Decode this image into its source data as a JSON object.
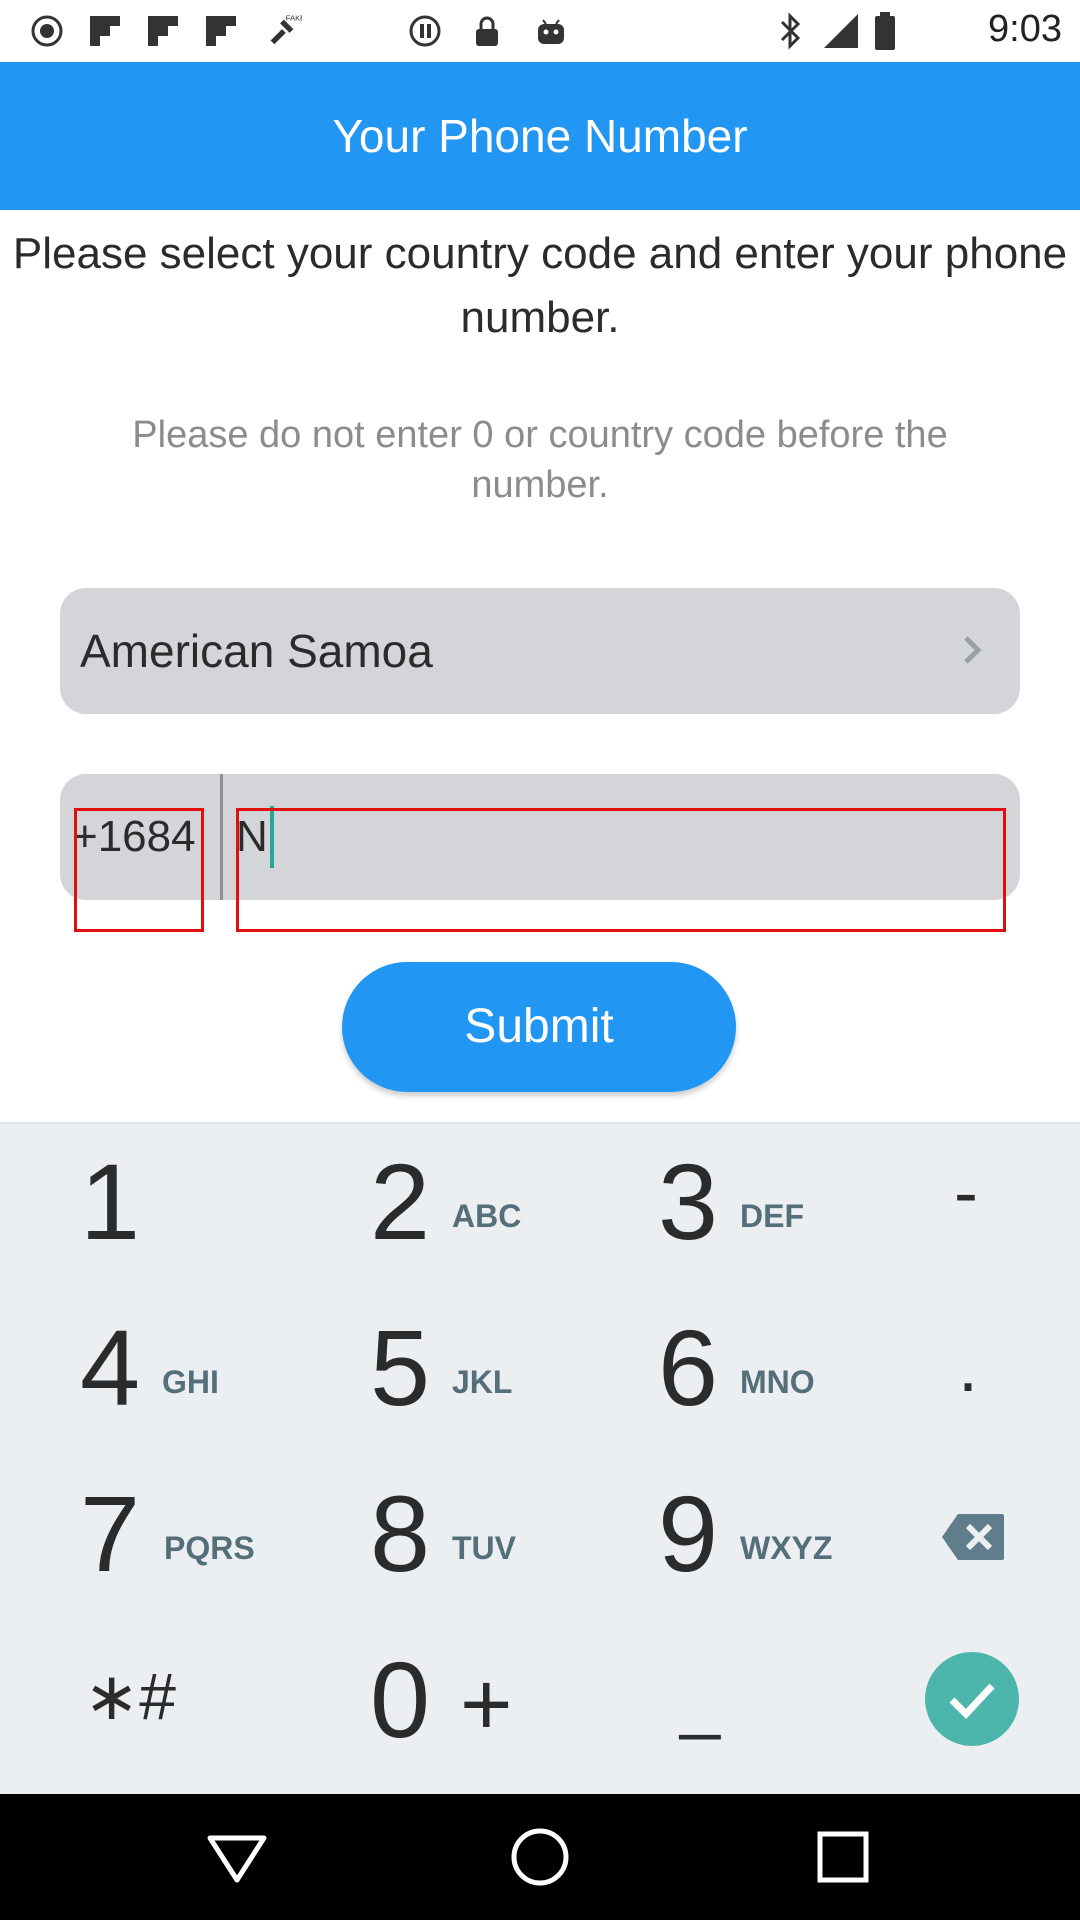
{
  "status_bar": {
    "time": "9:03",
    "icons": [
      "radio-icon",
      "flipboard-icon",
      "flipboard-icon",
      "flipboard-icon",
      "fake-gps-icon",
      "circle-icon",
      "lock-icon",
      "android-icon",
      "bluetooth-icon",
      "signal-icon",
      "battery-icon"
    ]
  },
  "app_bar": {
    "title": "Your Phone Number"
  },
  "instruction": "Please select your country code and enter your phone number.",
  "hint": "Please do not enter 0 or country code before the number.",
  "country_selector": {
    "value": "American Samoa",
    "icon": "chevron-right-icon"
  },
  "phone_field": {
    "country_code": "+1684",
    "value": "N"
  },
  "submit_button": {
    "label": "Submit",
    "color": "#2196f3"
  },
  "keypad": {
    "digits": [
      {
        "digit": "1",
        "letters": ""
      },
      {
        "digit": "2",
        "letters": "ABC"
      },
      {
        "digit": "3",
        "letters": "DEF"
      },
      {
        "digit": "4",
        "letters": "GHI"
      },
      {
        "digit": "5",
        "letters": "JKL"
      },
      {
        "digit": "6",
        "letters": "MNO"
      },
      {
        "digit": "7",
        "letters": "PQRS"
      },
      {
        "digit": "8",
        "letters": "TUV"
      },
      {
        "digit": "9",
        "letters": "WXYZ"
      },
      {
        "digit": "0",
        "letters": "+"
      }
    ],
    "dash": "-",
    "dot": ".",
    "star_hash": "∗#",
    "space": "_",
    "backspace_icon": "backspace-icon",
    "done_icon": "check-icon",
    "accent": "#4db6ac"
  },
  "nav_bar": {
    "icons": [
      "back-icon",
      "home-icon",
      "recents-icon"
    ]
  }
}
